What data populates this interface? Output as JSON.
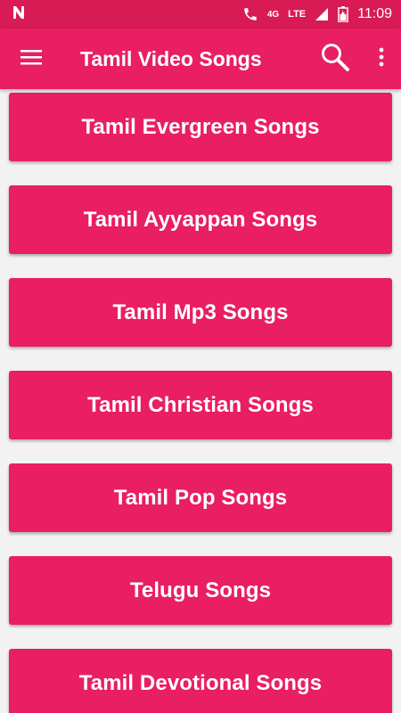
{
  "status_bar": {
    "network_small": "4G",
    "network": "LTE",
    "time": "11:09",
    "icons": [
      "n-notification-icon",
      "call-icon",
      "signal-icon",
      "battery-icon"
    ]
  },
  "app_bar": {
    "title": "Tamil Video Songs",
    "background": "#e91e63",
    "icons": [
      "menu-icon",
      "search-icon",
      "more-vert-icon"
    ]
  },
  "categories": [
    "Tamil Evergreen Songs",
    "Tamil Ayyappan Songs",
    "Tamil Mp3 Songs",
    "Tamil Christian Songs",
    "Tamil Pop Songs",
    "Telugu Songs",
    "Tamil Devotional Songs"
  ],
  "colors": {
    "primary": "#e91e63",
    "primary_dark": "#d81b55",
    "background": "#f2f2f2",
    "text": "#ffffff"
  }
}
